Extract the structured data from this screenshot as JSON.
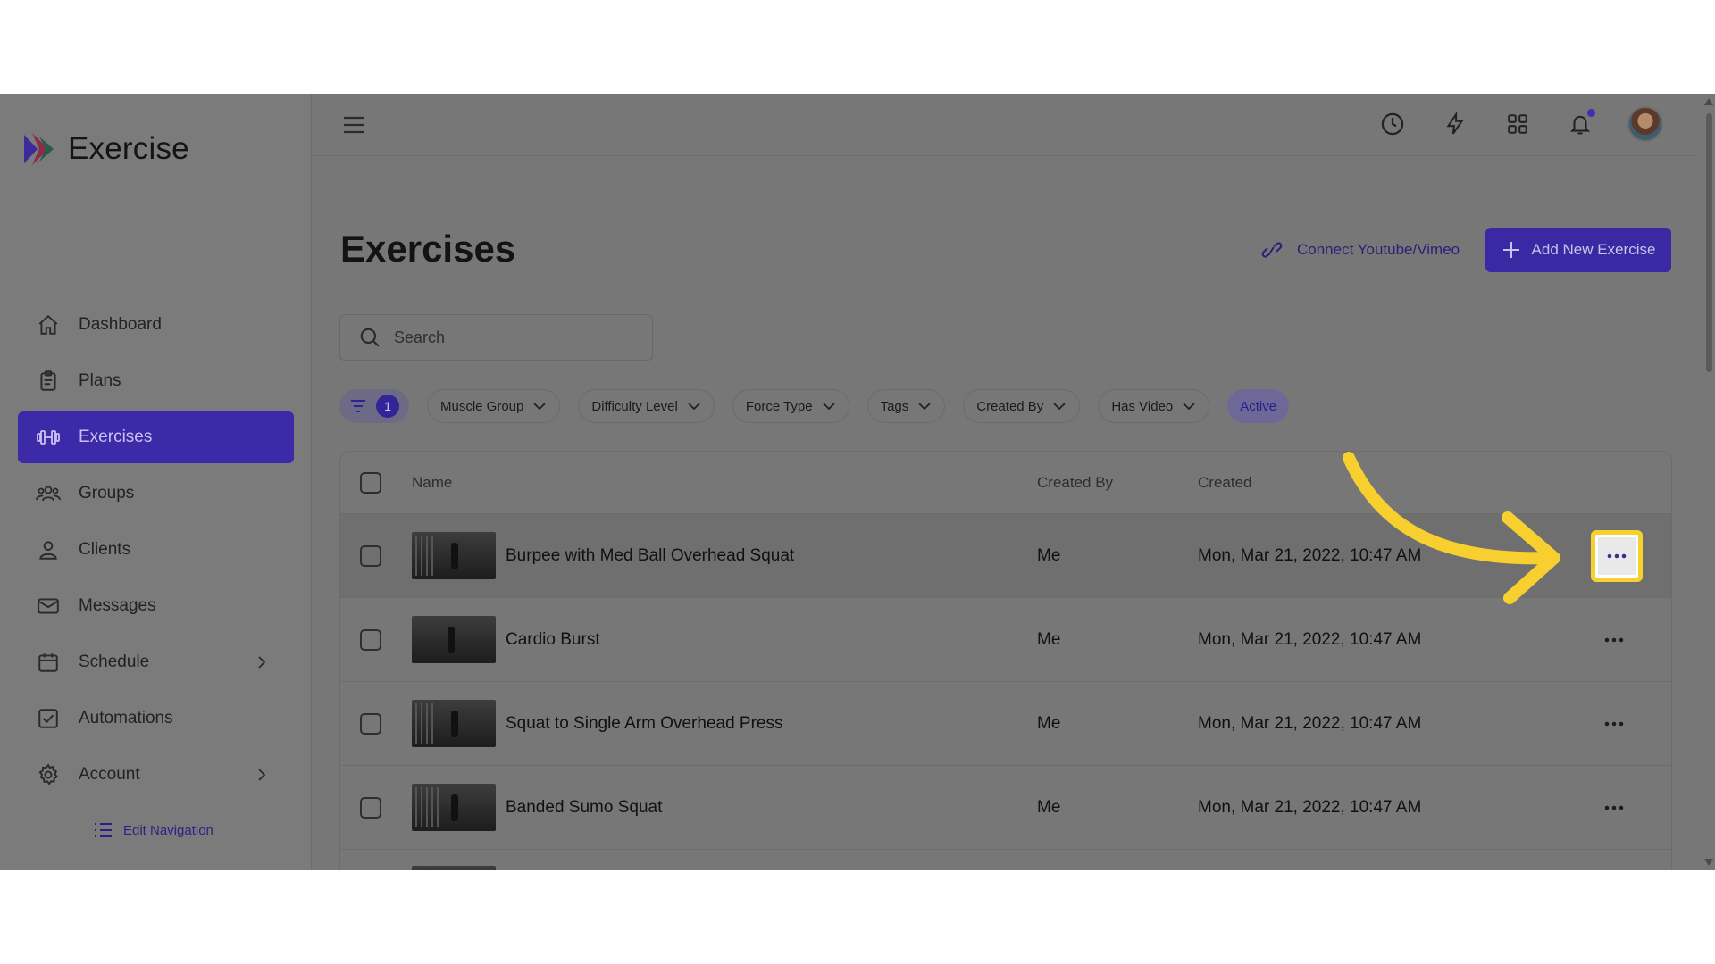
{
  "app": {
    "name": "Exercise"
  },
  "sidebar": {
    "items": [
      {
        "label": "Dashboard",
        "icon": "home-icon"
      },
      {
        "label": "Plans",
        "icon": "clipboard-icon"
      },
      {
        "label": "Exercises",
        "icon": "dumbbell-icon",
        "active": true
      },
      {
        "label": "Groups",
        "icon": "users-icon"
      },
      {
        "label": "Clients",
        "icon": "user-icon"
      },
      {
        "label": "Messages",
        "icon": "mail-icon"
      },
      {
        "label": "Schedule",
        "icon": "calendar-icon",
        "has_submenu": true
      },
      {
        "label": "Automations",
        "icon": "checkbox-icon"
      },
      {
        "label": "Account",
        "icon": "gear-icon",
        "has_submenu": true
      }
    ],
    "edit_navigation": "Edit Navigation"
  },
  "topbar": {
    "icons": [
      "clock-icon",
      "lightning-icon",
      "apps-grid-icon",
      "bell-icon",
      "avatar"
    ]
  },
  "page": {
    "title": "Exercises",
    "connect_link": "Connect Youtube/Vimeo",
    "add_button": "Add New Exercise",
    "search_placeholder": "Search"
  },
  "filters": {
    "active_count": "1",
    "chips": [
      "Muscle Group",
      "Difficulty Level",
      "Force Type",
      "Tags",
      "Created By",
      "Has Video"
    ],
    "status": "Active"
  },
  "table": {
    "columns": {
      "name": "Name",
      "created_by": "Created By",
      "created": "Created"
    },
    "rows": [
      {
        "name": "Burpee with Med Ball Overhead Squat",
        "created_by": "Me",
        "created": "Mon, Mar 21, 2022, 10:47 AM"
      },
      {
        "name": "Cardio Burst",
        "created_by": "Me",
        "created": "Mon, Mar 21, 2022, 10:47 AM"
      },
      {
        "name": "Squat to Single Arm Overhead Press",
        "created_by": "Me",
        "created": "Mon, Mar 21, 2022, 10:47 AM"
      },
      {
        "name": "Banded Sumo Squat",
        "created_by": "Me",
        "created": "Mon, Mar 21, 2022, 10:47 AM"
      }
    ]
  },
  "colors": {
    "accent": "#3d2aa8",
    "overlay": "#777777",
    "highlight": "#f7cf2e"
  }
}
